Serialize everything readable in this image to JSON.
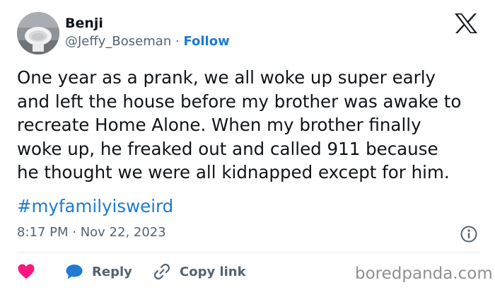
{
  "author": {
    "name": "Benji",
    "handle": "@Jeffy_Boseman",
    "separator": "·",
    "follow_label": "Follow",
    "avatar_icon": "toilet-photo-avatar"
  },
  "brand_icon": "x-logo-icon",
  "tweet": {
    "text_lines": [
      "One year as a prank, we all woke up super early",
      "and left the house before my brother was awake to",
      "recreate Home Alone. When my brother finally",
      "woke up, he freaked out and called 911 because",
      "he thought we were all kidnapped except for him."
    ],
    "hashtag": "#myfamilyisweird",
    "timestamp": "8:17 PM · Nov 22, 2023"
  },
  "actions": {
    "like_icon": "heart-icon",
    "reply_label": "Reply",
    "reply_icon": "speech-bubble-icon",
    "copy_label": "Copy link",
    "copy_icon": "link-icon"
  },
  "watermark": "boredpanda.com",
  "colors": {
    "accent": "#1d7bd1",
    "like": "#f91880",
    "muted": "#536471",
    "text": "#0f1419"
  }
}
